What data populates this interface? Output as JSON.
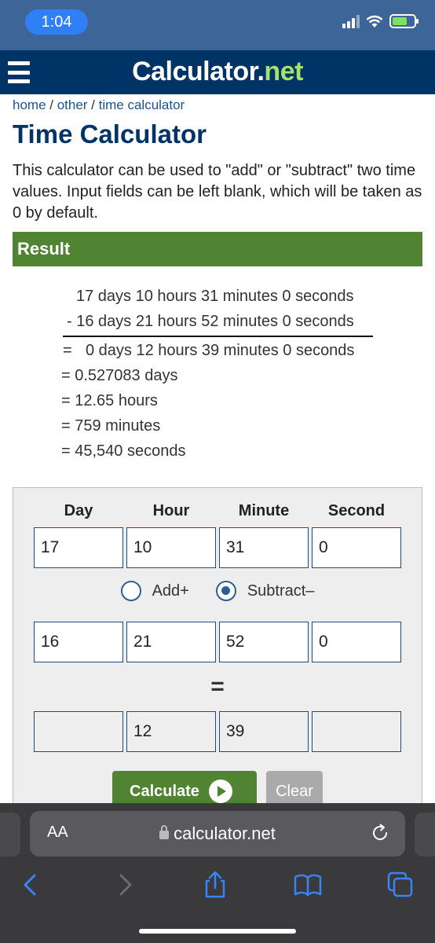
{
  "status_bar": {
    "time": "1:04"
  },
  "header": {
    "logo_part1": "Calculator.",
    "logo_part2": "net"
  },
  "breadcrumb": {
    "home": "home",
    "sep": " / ",
    "other": "other",
    "current": "time calculator"
  },
  "page": {
    "title": "Time Calculator",
    "description": "This calculator can be used to \"add\" or \"subtract\" two time values. Input fields can be left blank, which will be taken as 0 by default."
  },
  "result": {
    "heading": "Result",
    "line1": "17 days 10 hours 31 minutes 0 seconds",
    "line2": "- 16 days 21 hours 52 minutes 0 seconds",
    "line3_eq": "=",
    "line3": "0 days 12 hours 39 minutes 0 seconds",
    "days": "= 0.527083 days",
    "hours": "= 12.65 hours",
    "minutes": "= 759 minutes",
    "seconds": "= 45,540 seconds"
  },
  "form": {
    "headers": [
      "Day",
      "Hour",
      "Minute",
      "Second"
    ],
    "row1": [
      "17",
      "10",
      "31",
      "0"
    ],
    "row2": [
      "16",
      "21",
      "52",
      "0"
    ],
    "row3": [
      "",
      "12",
      "39",
      ""
    ],
    "add_label": "Add+",
    "subtract_label": "Subtract–",
    "selected_operation": "subtract",
    "equals": "=",
    "calculate_label": "Calculate",
    "clear_label": "Clear"
  },
  "browser": {
    "aa_label": "AA",
    "url": "calculator.net"
  },
  "colors": {
    "header_bg": "#003366",
    "status_bar_bg": "#3d6597",
    "result_bar": "#518432",
    "logo_accent": "#a4e26b",
    "link": "#1a5299",
    "safari_blue": "#3a82f7"
  },
  "icons": [
    "hamburger-menu-icon",
    "signal-icon",
    "wifi-icon",
    "battery-icon",
    "play-icon",
    "lock-icon",
    "reload-icon",
    "back-icon",
    "forward-icon",
    "share-icon",
    "bookmarks-icon",
    "tabs-icon"
  ]
}
